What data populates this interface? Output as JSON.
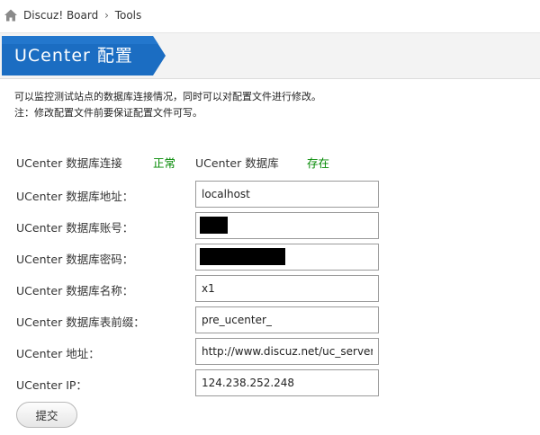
{
  "breadcrumb": {
    "home_icon": "home-icon",
    "board": "Discuz! Board",
    "separator": "›",
    "current": "Tools"
  },
  "page_title": "UCenter 配置",
  "description": [
    "可以监控测试站点的数据库连接情况，同时可以对配置文件进行修改。",
    "注：修改配置文件前要保证配置文件可写。"
  ],
  "status": {
    "conn_label": "UCenter 数据库连接",
    "conn_value": "正常",
    "db_label": "UCenter 数据库",
    "db_value": "存在"
  },
  "fields": {
    "host": {
      "label": "UCenter 数据库地址：",
      "value": "localhost"
    },
    "user": {
      "label": "UCenter 数据库账号：",
      "value": ""
    },
    "pass": {
      "label": "UCenter 数据库密码：",
      "value": ""
    },
    "name": {
      "label": "UCenter 数据库名称：",
      "value": "x1"
    },
    "prefix": {
      "label": "UCenter 数据库表前缀：",
      "value": "pre_ucenter_"
    },
    "url": {
      "label": "UCenter 地址：",
      "value": "http://www.discuz.net/uc_server"
    },
    "ip": {
      "label": "UCenter IP：",
      "value": "124.238.252.248"
    }
  },
  "submit_label": "提交",
  "colors": {
    "title_bg": "#1b6dc2",
    "status_ok": "#008800"
  }
}
